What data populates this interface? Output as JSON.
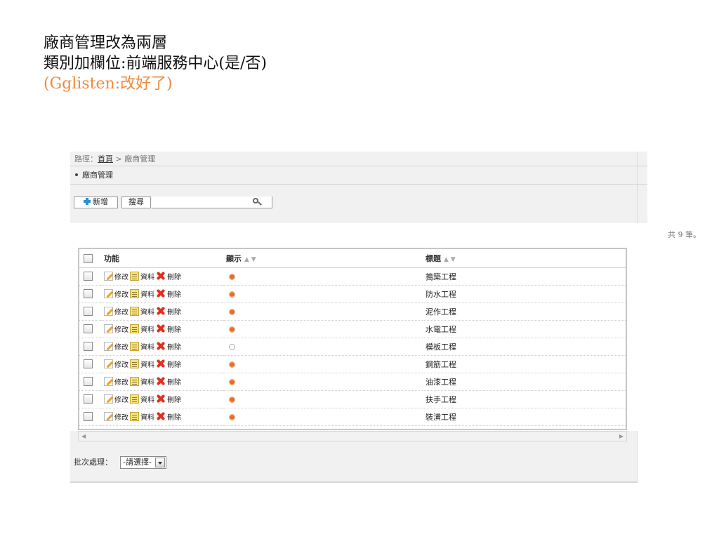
{
  "notes": [
    "廠商管理改為兩層",
    "類別加欄位:前端服務中心(是/否)",
    "(Gglisten:改好了)"
  ],
  "breadcrumb": {
    "prefix": "路徑：",
    "home": "首頁",
    "separator": " > ",
    "current": "廠商管理"
  },
  "section_title": "廠商管理",
  "toolbar": {
    "add_label": "新增",
    "search_label": "搜尋",
    "search_value": "",
    "search_placeholder": ""
  },
  "count_text": "共 9 筆。",
  "table": {
    "headers": {
      "function": "功能",
      "display": "顯示",
      "title": "標題",
      "sort_arrows": "▲ ▼"
    },
    "actions": {
      "edit": "修改",
      "data": "資料",
      "delete": "刪除"
    },
    "rows": [
      {
        "title": "搗築工程",
        "display": true
      },
      {
        "title": "防水工程",
        "display": true
      },
      {
        "title": "泥作工程",
        "display": true
      },
      {
        "title": "水電工程",
        "display": true
      },
      {
        "title": "模板工程",
        "display": false
      },
      {
        "title": "鋼筋工程",
        "display": true
      },
      {
        "title": "油漆工程",
        "display": true
      },
      {
        "title": "扶手工程",
        "display": true
      },
      {
        "title": "裝潢工程",
        "display": true
      }
    ]
  },
  "batch": {
    "label": "批次處理：",
    "selected": "-請選擇-"
  },
  "colors": {
    "note_accent": "#ef8a3c",
    "add_icon": "#2b8fd8",
    "delete_icon": "#e0301e",
    "display_on": "#ee6a1e"
  },
  "icons": {
    "add": "plus-icon",
    "search": "magnifier-icon",
    "edit": "pencil-icon",
    "data": "document-icon",
    "delete": "x-icon",
    "dropdown": "chevron-down-icon"
  }
}
